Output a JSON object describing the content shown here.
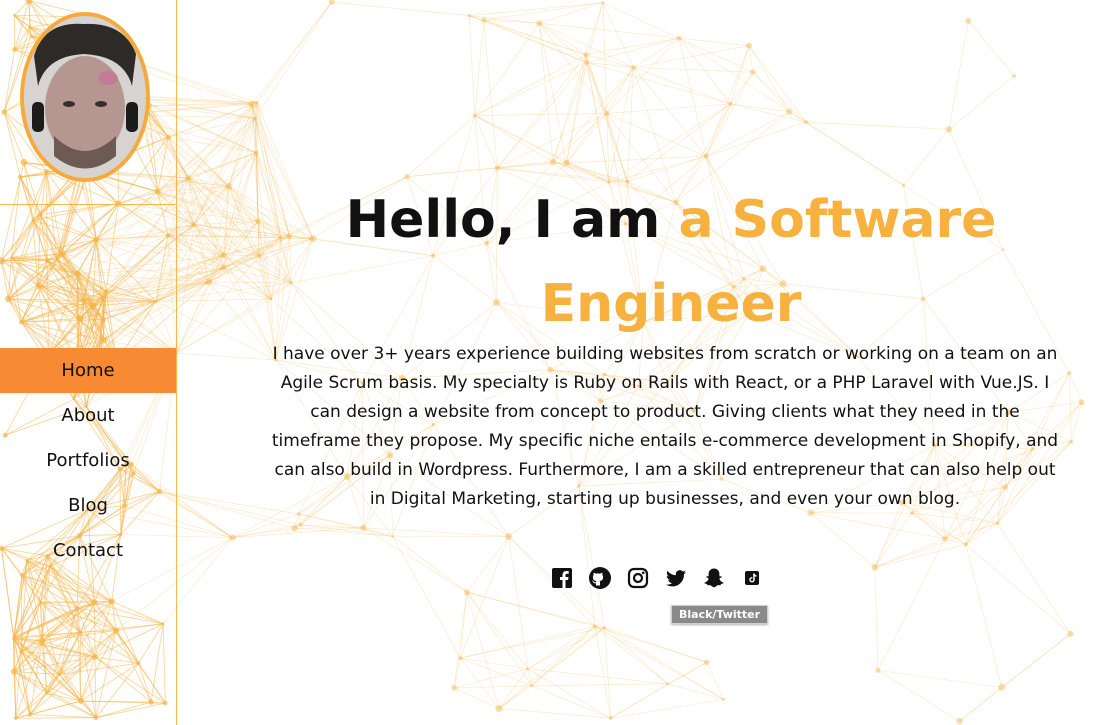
{
  "nav": {
    "items": [
      {
        "label": "Home",
        "active": true
      },
      {
        "label": "About",
        "active": false
      },
      {
        "label": "Portfolios",
        "active": false
      },
      {
        "label": "Blog",
        "active": false
      },
      {
        "label": "Contact",
        "active": false
      }
    ]
  },
  "hero": {
    "greeting": "Hello, I am",
    "role_line1": "a Software",
    "role_line2": "Engineer",
    "bio": "I have over 3+ years experience building websites from scratch or working on a team on an Agile Scrum basis. My specialty is Ruby on Rails with React, or a PHP Laravel with Vue.JS. I can design a website from concept to product. Giving clients what they need in the timeframe they propose. My specific niche entails e-commerce development in Shopify, and can also build in Wordpress. Furthermore, I am a skilled entrepreneur that can also help out in Digital Marketing, starting up businesses, and even your own blog."
  },
  "social": {
    "icons": [
      "facebook-icon",
      "github-icon",
      "instagram-icon",
      "twitter-icon",
      "snapchat-icon",
      "tiktok-icon"
    ],
    "tooltip": "Black/Twitter"
  },
  "colors": {
    "accent": "#f7b13f",
    "nav_active": "#f78a33",
    "network_lines": "#f5b54a"
  }
}
